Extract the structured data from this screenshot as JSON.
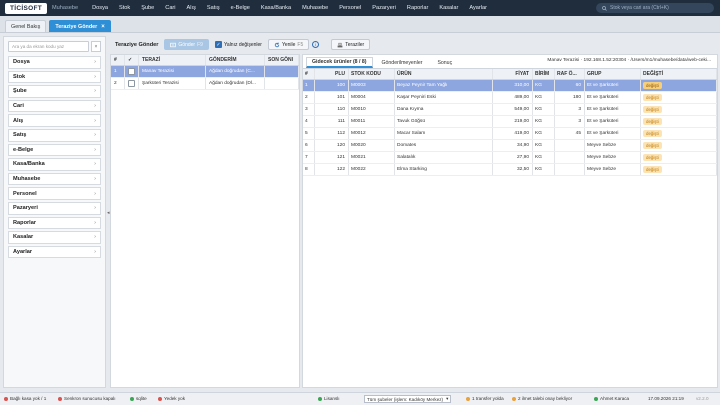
{
  "app": {
    "logo": "TİCİSOFT",
    "module": "Muhasebe"
  },
  "menu": [
    "Dosya",
    "Stok",
    "Şube",
    "Cari",
    "Alış",
    "Satış",
    "e-Belge",
    "Kasa/Banka",
    "Muhasebe",
    "Personel",
    "Pazaryeri",
    "Raporlar",
    "Kasalar",
    "Ayarlar"
  ],
  "search": {
    "placeholder": "Stok veya cari ara (Ctrl+K)"
  },
  "tabs": {
    "home": "Genel Bakış",
    "active": "Teraziye Gönder",
    "close": "×"
  },
  "sidebar": {
    "search_placeholder": "Ara ya da ekran kodu yaz",
    "clear": "×",
    "items": [
      "Dosya",
      "Stok",
      "Şube",
      "Cari",
      "Alış",
      "Satış",
      "e-Belge",
      "Kasa/Banka",
      "Muhasebe",
      "Personel",
      "Pazaryeri",
      "Raporlar",
      "Kasalar",
      "Ayarlar"
    ],
    "collapse": "◂"
  },
  "toolbar": {
    "title": "Teraziye Gönder",
    "send": "Gönder",
    "send_key": "F9",
    "only_changed": "Yalnız değişenler",
    "refresh": "Yenile",
    "refresh_key": "F5",
    "scales": "Teraziler"
  },
  "scales_table": {
    "headers": [
      "#",
      "✓",
      "TERAZİ",
      "GÖNDERİM",
      "SON GÖNI"
    ],
    "rows": [
      {
        "no": "1",
        "name": "Manav Terazisi",
        "send": "Ağdan doğrudan (C..."
      },
      {
        "no": "2",
        "name": "Şarküteri Terazisi",
        "send": "Ağdan doğrudan (Dl..."
      }
    ]
  },
  "right": {
    "tabs": [
      "Gidecek ürünler (8 / 8)",
      "Gönderilmeyenler",
      "Sonuç"
    ],
    "path": "Manav Terazisi · 192.168.1.52:20304 · /Users/m1/muhasebe/data/web-ceki...",
    "headers": [
      "#",
      "PLU",
      "STOK KODU",
      "ÜRÜN",
      "FİYAT",
      "BİRİM",
      "RAF Ö...",
      "GRUP",
      "DEĞİŞTİ"
    ],
    "rows": [
      {
        "no": "1",
        "plu": "100",
        "code": "M0003",
        "name": "Beyaz Peynir Tam Yağlı",
        "price": "310,00",
        "unit": "KG",
        "shelf": "60",
        "group": "Et ve Şarküteri",
        "changed": "değişti"
      },
      {
        "no": "2",
        "plu": "101",
        "code": "M0004",
        "name": "Kaşar Peyniri Eski",
        "price": "489,00",
        "unit": "KG",
        "shelf": "180",
        "group": "Et ve Şarküteri",
        "changed": "değişti"
      },
      {
        "no": "3",
        "plu": "110",
        "code": "M0010",
        "name": "Dana Kıyma",
        "price": "549,00",
        "unit": "KG",
        "shelf": "3",
        "group": "Et ve Şarküteri",
        "changed": "değişti"
      },
      {
        "no": "4",
        "plu": "111",
        "code": "M0011",
        "name": "Tavuk Göğsü",
        "price": "219,00",
        "unit": "KG",
        "shelf": "3",
        "group": "Et ve Şarküteri",
        "changed": "değişti"
      },
      {
        "no": "5",
        "plu": "112",
        "code": "M0012",
        "name": "Macar Salam",
        "price": "419,00",
        "unit": "KG",
        "shelf": "45",
        "group": "Et ve Şarküteri",
        "changed": "değişti"
      },
      {
        "no": "6",
        "plu": "120",
        "code": "M0020",
        "name": "Domates",
        "price": "34,90",
        "unit": "KG",
        "shelf": "",
        "group": "Meyve Sebze",
        "changed": "değişti"
      },
      {
        "no": "7",
        "plu": "121",
        "code": "M0021",
        "name": "Salatalık",
        "price": "27,90",
        "unit": "KG",
        "shelf": "",
        "group": "Meyve Sebze",
        "changed": "değişti"
      },
      {
        "no": "8",
        "plu": "122",
        "code": "M0022",
        "name": "Elma Starking",
        "price": "32,50",
        "unit": "KG",
        "shelf": "",
        "group": "Meyve Sebze",
        "changed": "değişti"
      }
    ]
  },
  "status": {
    "register": "Bağlı kasa yok / 1",
    "server": "Senkron sunucusu kapalı",
    "db": "sqlite",
    "backup": "Yedek yok",
    "license": "Lisanslı",
    "branch": "Tüm şubeler (işlem: Kadıköy Merkez)",
    "transfer": "1 transfer yolda",
    "pending": "2 ilmet talebi onay bekliyor",
    "user": "Ahmet Karaca",
    "datetime": "17.09.2026 21:19",
    "version": "v2.2.0",
    "colors": {
      "red": "#d9534f",
      "green": "#3aa655",
      "orange": "#e8a33d"
    }
  }
}
